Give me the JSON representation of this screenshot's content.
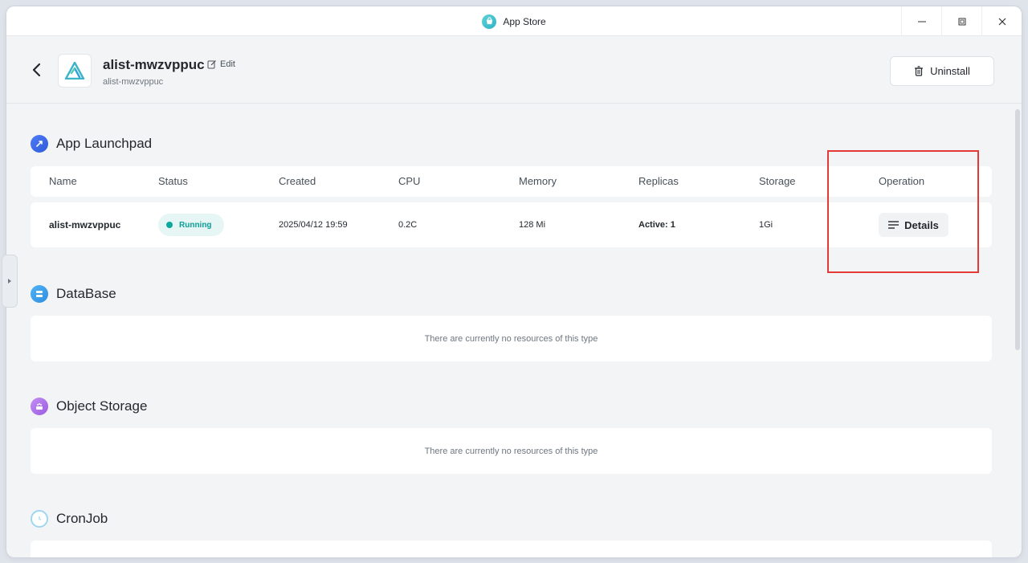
{
  "window": {
    "title": "App Store",
    "controls": {
      "minimize": "minimize-icon",
      "maximize": "maximize-icon",
      "close": "close-icon"
    }
  },
  "header": {
    "app_name": "alist-mwzvppuc",
    "app_subtitle": "alist-mwzvppuc",
    "edit_label": "Edit",
    "uninstall_label": "Uninstall"
  },
  "sections": {
    "launchpad": {
      "title": "App Launchpad",
      "columns": [
        "Name",
        "Status",
        "Created",
        "CPU",
        "Memory",
        "Replicas",
        "Storage",
        "Operation"
      ],
      "rows": [
        {
          "name": "alist-mwzvppuc",
          "status": "Running",
          "created": "2025/04/12 19:59",
          "cpu": "0.2C",
          "memory": "128 Mi",
          "replicas": "Active: 1",
          "storage": "1Gi",
          "operation": "Details"
        }
      ]
    },
    "database": {
      "title": "DataBase",
      "empty_text": "There are currently no resources of this type"
    },
    "object_storage": {
      "title": "Object Storage",
      "empty_text": "There are currently no resources of this type"
    },
    "cronjob": {
      "title": "CronJob"
    }
  },
  "colors": {
    "accent": "#0aa89d",
    "highlight": "#e53935",
    "background": "#f3f4f6"
  }
}
